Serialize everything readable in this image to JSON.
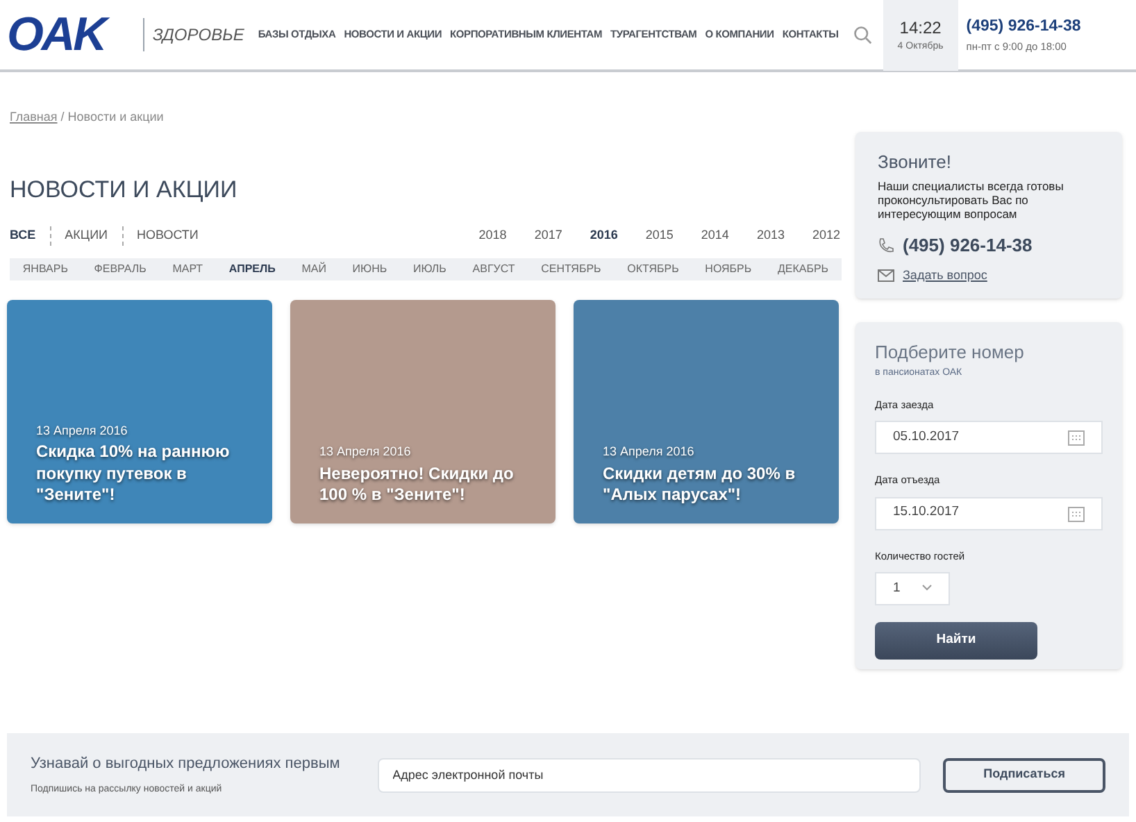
{
  "header": {
    "logo": "OAK",
    "brand_sub": "ЗДОРОВЬЕ",
    "nav": [
      "БАЗЫ ОТДЫХА",
      "НОВОСТИ И АКЦИИ",
      "КОРПОРАТИВНЫМ КЛИЕНТАМ",
      "ТУРАГЕНТСТВАМ",
      "О КОМПАНИИ",
      "КОНТАКТЫ"
    ],
    "time": "14:22",
    "date": "4 Октябрь",
    "phone": "(495) 926-14-38",
    "hours": "пн-пт с 9:00 до 18:00"
  },
  "breadcrumb": {
    "link": "Главная",
    "current": "/ Новости и акции"
  },
  "page_title": "НОВОСТИ И АКЦИИ",
  "type_filters": [
    {
      "label": "ВСЕ",
      "selected": true
    },
    {
      "label": "АКЦИИ",
      "selected": false
    },
    {
      "label": "НОВОСТИ",
      "selected": false
    }
  ],
  "years": [
    {
      "label": "2018",
      "selected": false
    },
    {
      "label": "2017",
      "selected": false
    },
    {
      "label": "2016",
      "selected": true
    },
    {
      "label": "2015",
      "selected": false
    },
    {
      "label": "2014",
      "selected": false
    },
    {
      "label": "2013",
      "selected": false
    },
    {
      "label": "2012",
      "selected": false
    }
  ],
  "months": [
    {
      "label": "ЯНВАРЬ",
      "selected": false
    },
    {
      "label": "ФЕВРАЛЬ",
      "selected": false
    },
    {
      "label": "МАРТ",
      "selected": false
    },
    {
      "label": "АПРЕЛЬ",
      "selected": true
    },
    {
      "label": "МАЙ",
      "selected": false
    },
    {
      "label": "ИЮНЬ",
      "selected": false
    },
    {
      "label": "ИЮЛЬ",
      "selected": false
    },
    {
      "label": "АВГУСТ",
      "selected": false
    },
    {
      "label": "СЕНТЯБРЬ",
      "selected": false
    },
    {
      "label": "ОКТЯБРЬ",
      "selected": false
    },
    {
      "label": "НОЯБРЬ",
      "selected": false
    },
    {
      "label": "ДЕКАБРЬ",
      "selected": false
    }
  ],
  "news": [
    {
      "date": "13 Апреля 2016",
      "title": "Скидка 10% на раннюю покупку путевок в \"Зените\"!",
      "color": "#3f86b8"
    },
    {
      "date": "13 Апреля 2016",
      "title": "Невероятно! Скидки до 100 % в \"Зените\"!",
      "color": "#b49a8e"
    },
    {
      "date": "13 Апреля 2016",
      "title": "Скидки детям до 30% в \"Алых парусах\"!",
      "color": "#4d80a8"
    }
  ],
  "call_card": {
    "title": "Звоните!",
    "text": "Наши специалисты всегда готовы проконсультировать Вас по интересующим вопросам",
    "phone": "(495) 926-14-38",
    "ask_link": "Задать вопрос"
  },
  "booking": {
    "title": "Подберите номер",
    "subtitle": "в пансионатах ОАК",
    "checkin_label": "Дата заезда",
    "checkin": "05.10.2017",
    "checkout_label": "Дата отъезда",
    "checkout": "15.10.2017",
    "guests_label": "Количество гостей",
    "guests": "1",
    "button": "Найти"
  },
  "subscribe": {
    "title": "Узнавай о выгодных предложениях первым",
    "subtitle": "Подпишись на рассылку новостей и акций",
    "placeholder": "Адрес электронной почты",
    "button": "Подписаться"
  }
}
